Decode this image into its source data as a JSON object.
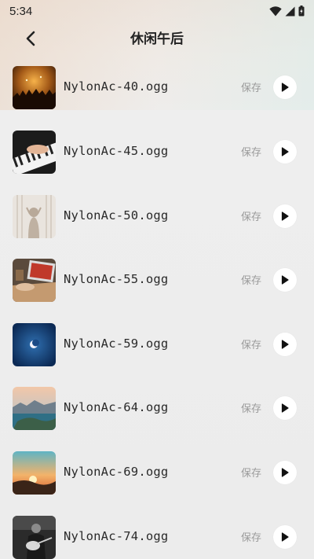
{
  "status_bar": {
    "time": "5:34",
    "icons": [
      "wifi-icon",
      "signal-icon",
      "battery-icon"
    ]
  },
  "header": {
    "title": "休闲午后",
    "back_icon": "chevron-left-icon"
  },
  "tracks": [
    {
      "name": "NylonAc-40.ogg",
      "save_label": "保存",
      "thumb": "concert-crowd"
    },
    {
      "name": "NylonAc-45.ogg",
      "save_label": "保存",
      "thumb": "piano-hands"
    },
    {
      "name": "NylonAc-50.ogg",
      "save_label": "保存",
      "thumb": "curtain-silhouette"
    },
    {
      "name": "NylonAc-55.ogg",
      "save_label": "保存",
      "thumb": "laptop-desk"
    },
    {
      "name": "NylonAc-59.ogg",
      "save_label": "保存",
      "thumb": "crescent-moon"
    },
    {
      "name": "NylonAc-64.ogg",
      "save_label": "保存",
      "thumb": "lake-mountains"
    },
    {
      "name": "NylonAc-69.ogg",
      "save_label": "保存",
      "thumb": "sunset-hills"
    },
    {
      "name": "NylonAc-74.ogg",
      "save_label": "保存",
      "thumb": "guitar-player"
    }
  ],
  "colors": {
    "play_button_bg": "#ffffff",
    "save_text": "#9a9a9a",
    "title_text": "#222222"
  }
}
